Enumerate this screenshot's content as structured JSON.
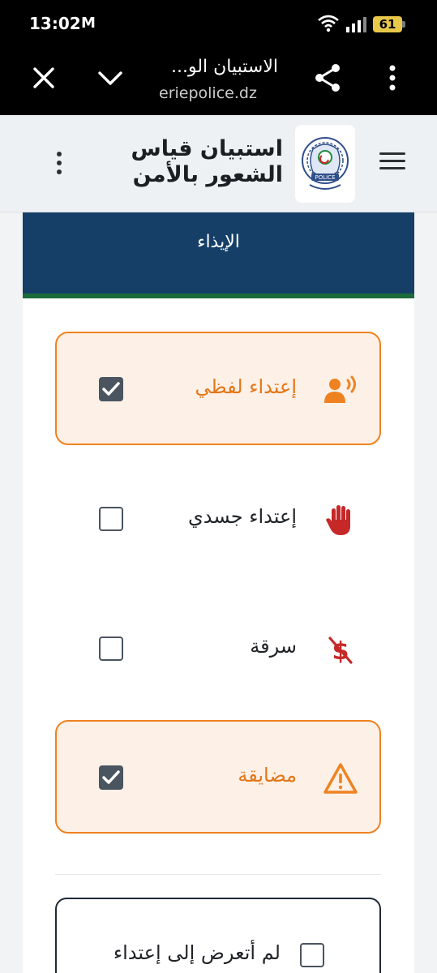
{
  "status_bar": {
    "time": "13:02",
    "mail_glyph": "M",
    "battery": "61"
  },
  "browser": {
    "page_title": "الاستبيان الو...",
    "url": "eriepolice.dz",
    "icons": [
      "close-icon",
      "chevron-down-icon",
      "share-icon",
      "more-vert-icon"
    ]
  },
  "header": {
    "title_line1": "استبيان قياس",
    "title_line2": "الشعور بالأمن",
    "logo_icon": "police-emblem-icon",
    "menu_icon": "hamburger-menu-icon",
    "kebab_icon": "more-vert-icon"
  },
  "section": {
    "banner_title": "الإيذاء"
  },
  "options": [
    {
      "label": "إعتداء لفظي",
      "icon": "verbal-abuse-icon",
      "checked": true
    },
    {
      "label": "إعتداء جسدي",
      "icon": "hand-stop-icon",
      "checked": false
    },
    {
      "label": "سرقة",
      "icon": "money-off-icon",
      "checked": false
    },
    {
      "label": "مضايقة",
      "icon": "warning-triangle-icon",
      "checked": true
    }
  ],
  "none_option": {
    "label": "لم أتعرض إلى إعتداء",
    "checked": false
  },
  "colors": {
    "accent": "#ef8220",
    "banner": "#153f67",
    "banner_stripe": "#1c6b3a",
    "danger": "#c62828"
  }
}
